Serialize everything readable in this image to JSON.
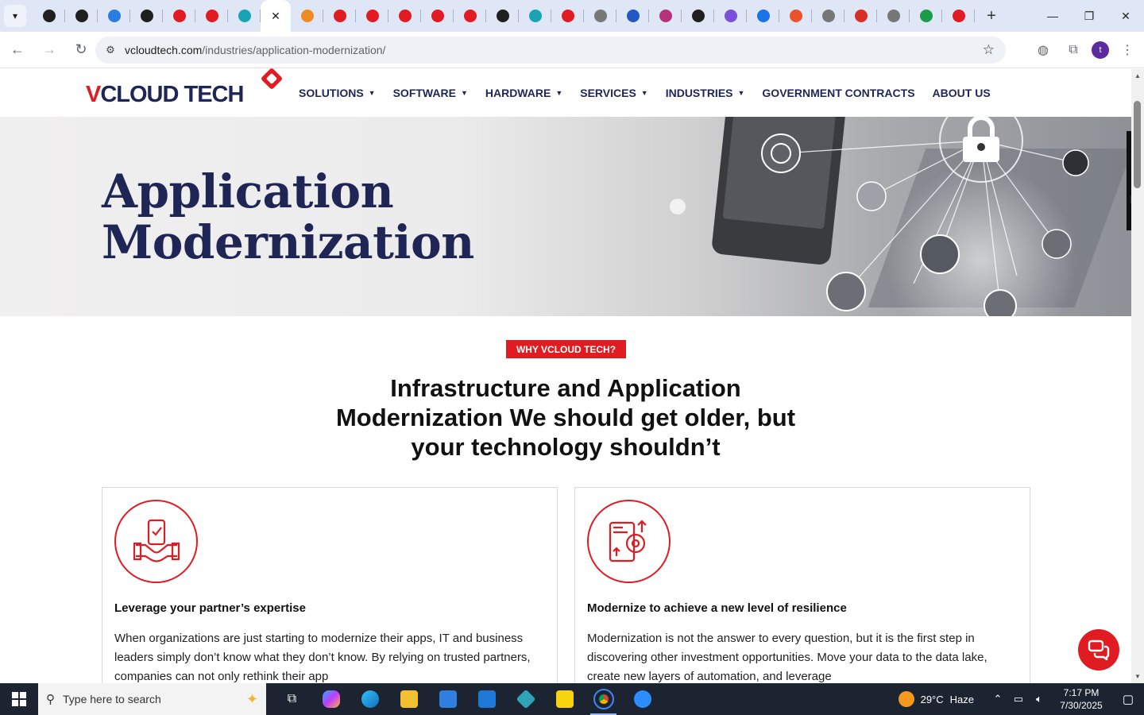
{
  "browser": {
    "tabs": [
      {
        "color": "#1f1f1f"
      },
      {
        "color": "#1f1f1f"
      },
      {
        "color": "#2a7de1"
      },
      {
        "color": "#1f1f1f"
      },
      {
        "color": "#e11b22"
      },
      {
        "color": "#e11b22"
      },
      {
        "color": "#1aa3b5"
      },
      {
        "active": true
      },
      {
        "color": "#f08a24"
      },
      {
        "color": "#e11b22"
      },
      {
        "color": "#e11b22"
      },
      {
        "color": "#e11b22"
      },
      {
        "color": "#e11b22"
      },
      {
        "color": "#e11b22"
      },
      {
        "color": "#1f1f1f"
      },
      {
        "color": "#1aa3b5"
      },
      {
        "color": "#e11b22"
      },
      {
        "color": "#777777"
      },
      {
        "color": "#2358c4"
      },
      {
        "color": "#b5337a"
      },
      {
        "color": "#1f1f1f"
      },
      {
        "color": "#7b4fd8"
      },
      {
        "color": "#1a73e8"
      },
      {
        "color": "#e8532c"
      },
      {
        "color": "#777777"
      },
      {
        "color": "#d93025"
      },
      {
        "color": "#777777"
      },
      {
        "color": "#1a9c4a"
      },
      {
        "color": "#e11b22"
      }
    ],
    "active_tab_close": "✕",
    "new_tab": "+",
    "window": {
      "minimize": "—",
      "maximize": "❐",
      "close": "✕"
    },
    "url_host": "vcloudtech.com",
    "url_path": "/industries/application-modernization/",
    "profile_initial": "t"
  },
  "site": {
    "logo_v": "V",
    "logo_rest": "CLOUD TECH",
    "nav": [
      {
        "label": "SOLUTIONS",
        "dropdown": true
      },
      {
        "label": "SOFTWARE",
        "dropdown": true
      },
      {
        "label": "HARDWARE",
        "dropdown": true
      },
      {
        "label": "SERVICES",
        "dropdown": true
      },
      {
        "label": "INDUSTRIES",
        "dropdown": true
      },
      {
        "label": "GOVERNMENT CONTRACTS",
        "dropdown": false
      },
      {
        "label": "ABOUT US",
        "dropdown": false
      }
    ],
    "hero": {
      "title_line1": "Application",
      "title_line2": "Modernization"
    },
    "section": {
      "badge": "WHY VCLOUD TECH?",
      "headline_line1": "Infrastructure and Application",
      "headline_line2": "Modernization We should get older, but",
      "headline_line3": "your technology shouldn’t"
    },
    "cards": [
      {
        "icon": "handshake-phone-icon",
        "title": "Leverage your partner’s expertise",
        "text": "When organizations are just starting to modernize their apps, IT and business leaders simply don’t know what they don’t know. By relying on trusted partners, companies can not only rethink their app"
      },
      {
        "icon": "mobile-gear-icon",
        "title": "Modernize to achieve a new level of resilience",
        "text": "Modernization is not the answer to every question, but it is the first step in discovering other investment opportunities. Move your data to the data lake, create new layers of automation, and leverage"
      }
    ],
    "brand_colors": {
      "navy": "#1f2656",
      "red": "#e11b22"
    }
  },
  "taskbar": {
    "search_placeholder": "Type here to search",
    "weather_temp": "29°C",
    "weather_desc": "Haze",
    "time": "7:17 PM",
    "date": "7/30/2025"
  }
}
